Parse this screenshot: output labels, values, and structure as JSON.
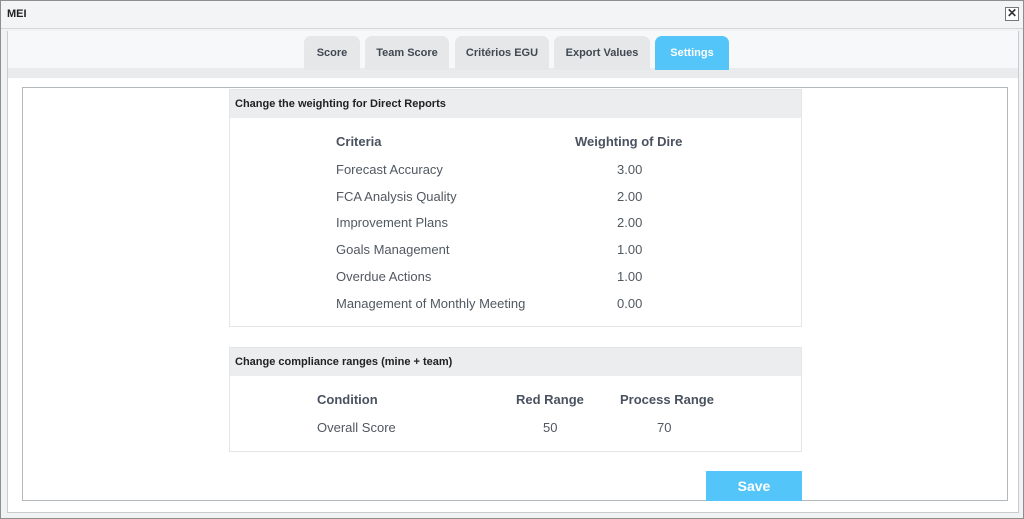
{
  "window": {
    "title": "MEI",
    "close_label": "✕"
  },
  "tabs": [
    {
      "label": "Score",
      "active": false
    },
    {
      "label": "Team Score",
      "active": false
    },
    {
      "label": "Critérios EGU",
      "active": false
    },
    {
      "label": "Export Values",
      "active": false
    },
    {
      "label": "Settings",
      "active": true
    }
  ],
  "weighting": {
    "header": "Change the weighting for Direct Reports",
    "col_criteria": "Criteria",
    "col_weighting": "Weighting of Dire",
    "rows": [
      {
        "criteria": "Forecast Accuracy",
        "weight": "3.00"
      },
      {
        "criteria": "FCA Analysis Quality",
        "weight": "2.00"
      },
      {
        "criteria": "Improvement Plans",
        "weight": "2.00"
      },
      {
        "criteria": "Goals Management",
        "weight": "1.00"
      },
      {
        "criteria": "Overdue Actions",
        "weight": "1.00"
      },
      {
        "criteria": "Management of Monthly Meeting",
        "weight": "0.00"
      }
    ]
  },
  "compliance": {
    "header": "Change compliance ranges (mine + team)",
    "col_condition": "Condition",
    "col_red": "Red Range",
    "col_process": "Process Range",
    "rows": [
      {
        "condition": "Overall Score",
        "red": "50",
        "process": "70"
      }
    ]
  },
  "actions": {
    "save_label": "Save"
  },
  "colors": {
    "accent": "#54c5f8",
    "tab_inactive": "#e5e7e8",
    "panel_header": "#ebedee"
  }
}
